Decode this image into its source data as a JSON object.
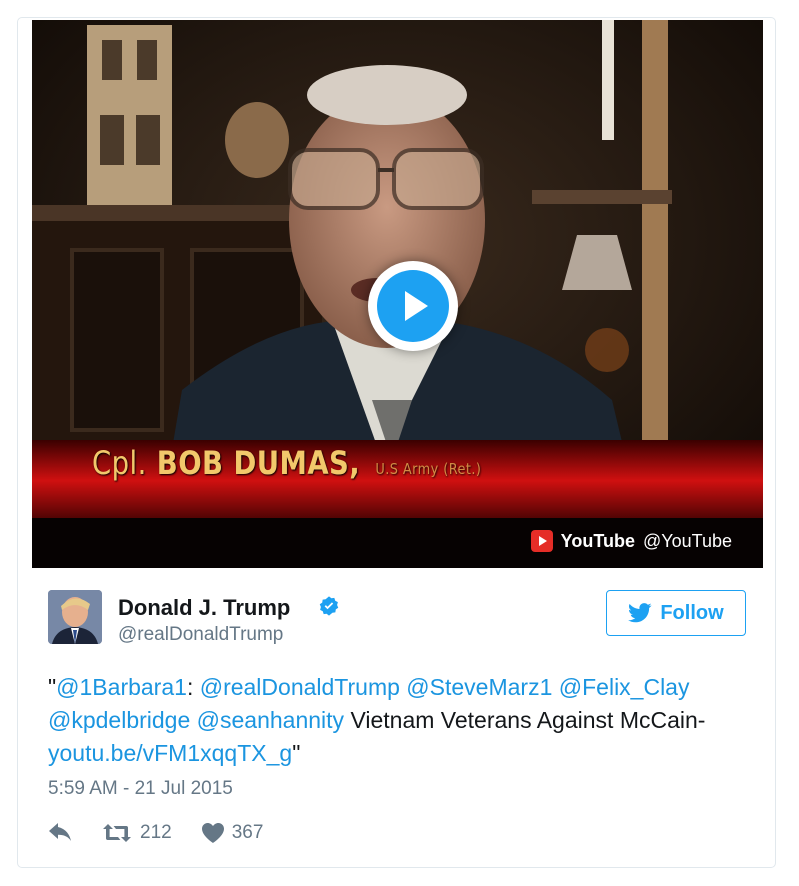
{
  "media": {
    "lower_third": {
      "rank": "Cpl.",
      "name": "BOB DUMAS,",
      "subtitle": "U.S Army (Ret.)"
    },
    "provider": {
      "name": "YouTube",
      "handle": "@YouTube",
      "icon": "youtube-icon"
    },
    "play_icon": "play-icon"
  },
  "author": {
    "name": "Donald J. Trump",
    "handle": "@realDonaldTrump",
    "verified_icon": "verified-badge-icon",
    "avatar": "avatar"
  },
  "follow_button": {
    "label": "Follow",
    "icon": "twitter-bird-icon"
  },
  "tweet": {
    "open_quote": "\"",
    "mention_1": "@1Barbara1",
    "colon": ": ",
    "mention_2": "@realDonaldTrump",
    "mention_3": "@SteveMarz1",
    "mention_4": "@Felix_Clay",
    "mention_5": "@kpdelbridge",
    "mention_6": "@seanhannity",
    "text_1": "Vietnam Veterans Against McCain-",
    "link": "youtu.be/vFM1xqqTX_g",
    "close_quote": "\""
  },
  "timestamp": "5:59 AM - 21 Jul 2015",
  "actions": {
    "reply_icon": "reply-icon",
    "retweet_icon": "retweet-icon",
    "retweet_count": "212",
    "like_icon": "heart-icon",
    "like_count": "367"
  },
  "colors": {
    "accent": "#1da1f2",
    "link": "#1b95e0",
    "secondary_text": "#657786",
    "youtube_red": "#e52d27"
  }
}
